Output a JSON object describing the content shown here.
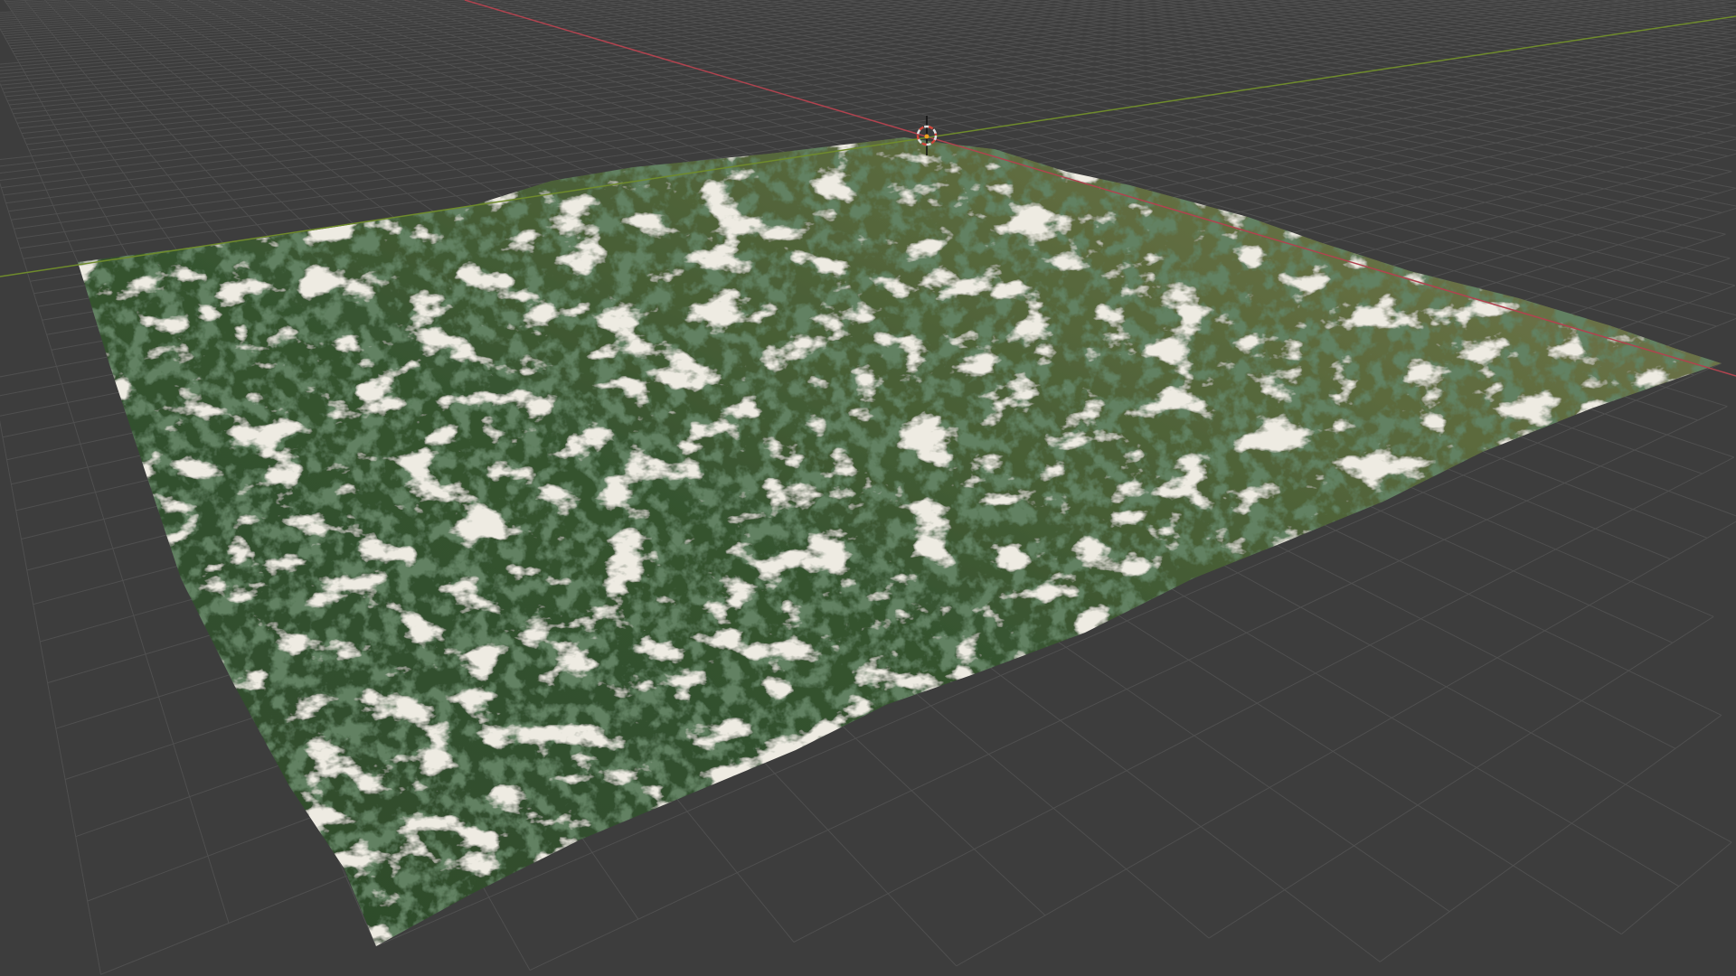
{
  "scene": {
    "view": "3d-viewport-perspective",
    "object": "terrain-mesh",
    "colors": {
      "background": "#3d3d3d",
      "grid_line": "#4f4f4f",
      "x_axis": "#b0434f",
      "y_axis": "#6f8b2c",
      "terrain_forest": "#2f4a2c",
      "terrain_meadow": "#6f7a48",
      "terrain_rock": "#c9c3b2",
      "cursor_ring": "#d0453a"
    },
    "grid": {
      "terrain_cells": 24
    }
  }
}
